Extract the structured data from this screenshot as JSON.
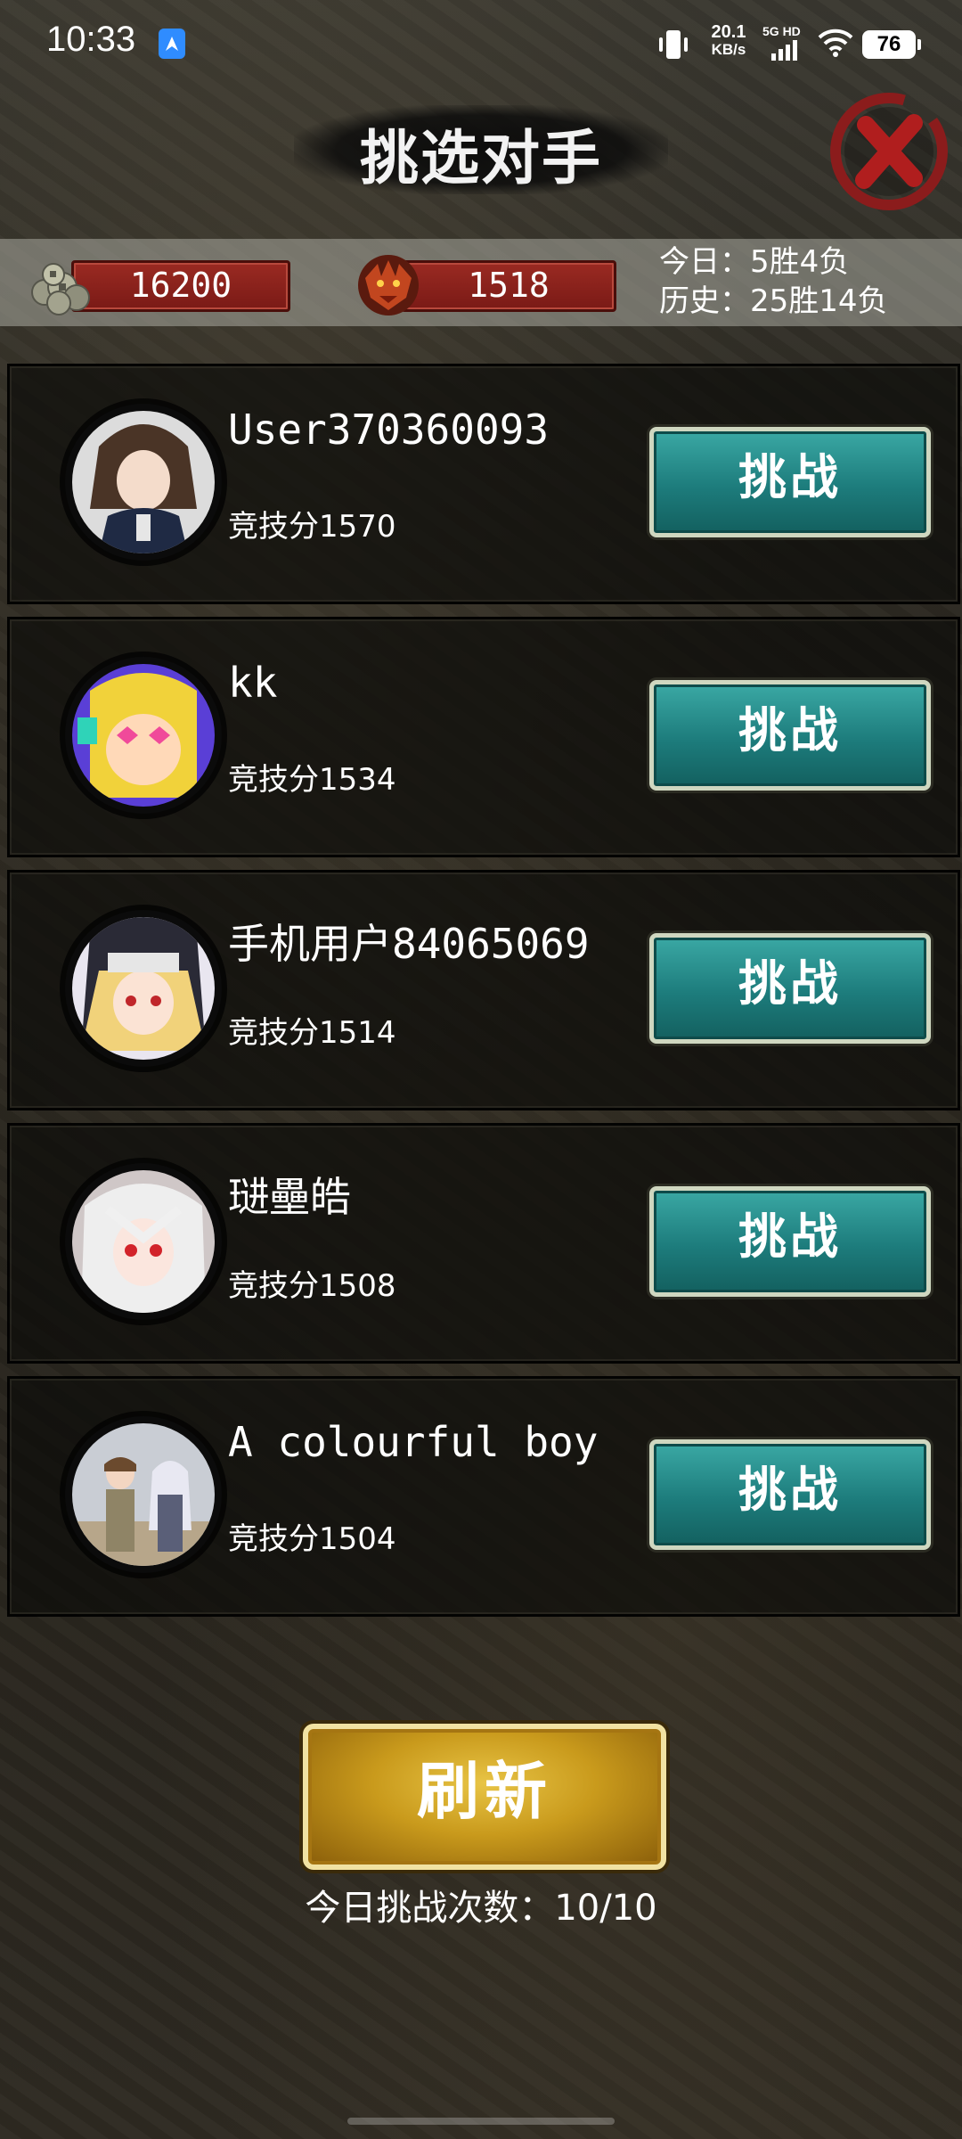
{
  "status_bar": {
    "time": "10:33",
    "net_speed_value": "20.1",
    "net_speed_unit": "KB/s",
    "network_type": "5G HD",
    "battery": "76"
  },
  "header": {
    "title": "挑选对手"
  },
  "stats": {
    "coins": "16200",
    "rank_points": "1518",
    "today_record": "今日：5胜4负",
    "history_record": "历史：25胜14负"
  },
  "opponents": [
    {
      "name": "User370360093",
      "score": "竞技分1570",
      "button": "挑战"
    },
    {
      "name": "kk",
      "score": "竞技分1534",
      "button": "挑战"
    },
    {
      "name": "手机用户84065069",
      "score": "竞技分1514",
      "button": "挑战"
    },
    {
      "name": "琎壘皓",
      "score": "竞技分1508",
      "button": "挑战"
    },
    {
      "name": "A colourful boy",
      "score": "竞技分1504",
      "button": "挑战"
    }
  ],
  "footer": {
    "refresh_label": "刷新",
    "challenge_count": "今日挑战次数：10/10"
  },
  "colors": {
    "challenge_button": "#1d7c7c",
    "refresh_button": "#c99a1c",
    "resource_plate": "#7a1a16"
  }
}
